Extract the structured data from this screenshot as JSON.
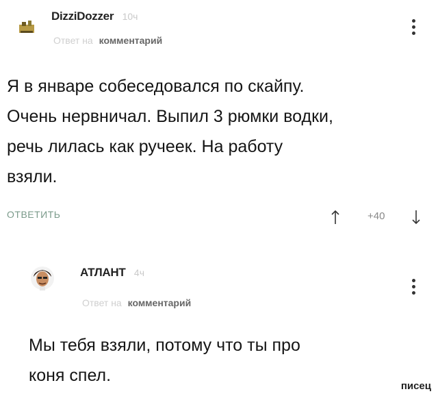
{
  "comments": [
    {
      "author": "DizziDozzer",
      "time": "10ч",
      "reply_prefix": "Ответ на",
      "reply_target": "комментарий",
      "text_lines": [
        "Я в январе собеседовался по скайпу.",
        "Очень нервничал. Выпил 3 рюмки водки,",
        "речь лилась как ручеек. На работу",
        "взяли."
      ],
      "reply_button": "ОТВЕТИТЬ",
      "score": "+40"
    },
    {
      "author": "АТЛАНТ",
      "time": "4ч",
      "reply_prefix": "Ответ на",
      "reply_target": "комментарий",
      "text_lines": [
        "Мы тебя взяли, потому что ты про",
        "коня спел."
      ]
    }
  ],
  "watermark": "писец",
  "colors": {
    "background": "#ffffff",
    "text": "#151515",
    "muted": "#cfcfcf",
    "reply_button": "#7a9a8a"
  },
  "icons": [
    "avatar-1",
    "kebab-menu-icon",
    "arrow-up-icon",
    "arrow-down-icon",
    "avatar-2"
  ]
}
